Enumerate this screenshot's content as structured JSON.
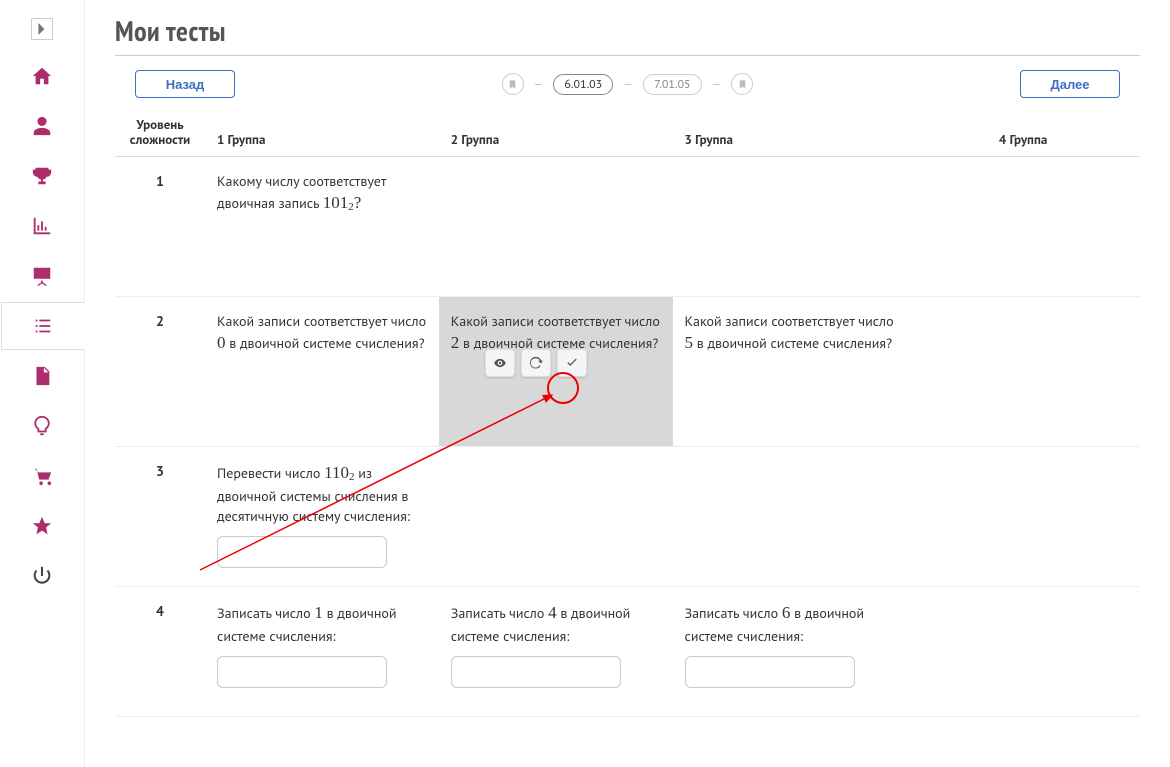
{
  "page": {
    "title": "Мои тесты"
  },
  "nav": {
    "back": "Назад",
    "next": "Далее",
    "crumb_active": "6.01.03",
    "crumb_inactive": "7.01.05"
  },
  "grid": {
    "head": {
      "level_l1": "Уровень",
      "level_l2": "сложности",
      "g1": "1 Группа",
      "g2": "2 Группа",
      "g3": "3 Группа",
      "g4": "4 Группа"
    },
    "rows": [
      {
        "num": "1",
        "g1_pre": "Какому числу соответствует двоичная запись ",
        "g1_math": "101",
        "g1_sub": "2",
        "g1_post": "?"
      },
      {
        "num": "2",
        "g1_pre": " Какой записи  соответствует число ",
        "g1_math": "0",
        "g1_post": "  в двоичной системе счисления?",
        "g2_pre": " Какой записи  соответствует число ",
        "g2_math": "2",
        "g2_post": "  в двоичной системе счисления?",
        "g3_pre": " Какой записи  соответствует число ",
        "g3_math": "5",
        "g3_post": "  в двоичной системе счисления?"
      },
      {
        "num": "3",
        "g1_pre": "Перевести число ",
        "g1_math": "110",
        "g1_sub": "2",
        "g1_post": "   из двоичной системы счисления в десятичную систему счисления:"
      },
      {
        "num": "4",
        "g1_pre": "Записать число ",
        "g1_math": "1",
        "g1_post": "  в двоичной системе счисления:",
        "g2_pre": "Записать число ",
        "g2_math": "4",
        "g2_post": "  в двоичной системе счисления:",
        "g3_pre": "Записать число ",
        "g3_math": "6",
        "g3_post": "  в двоичной системе счисления:"
      }
    ]
  }
}
